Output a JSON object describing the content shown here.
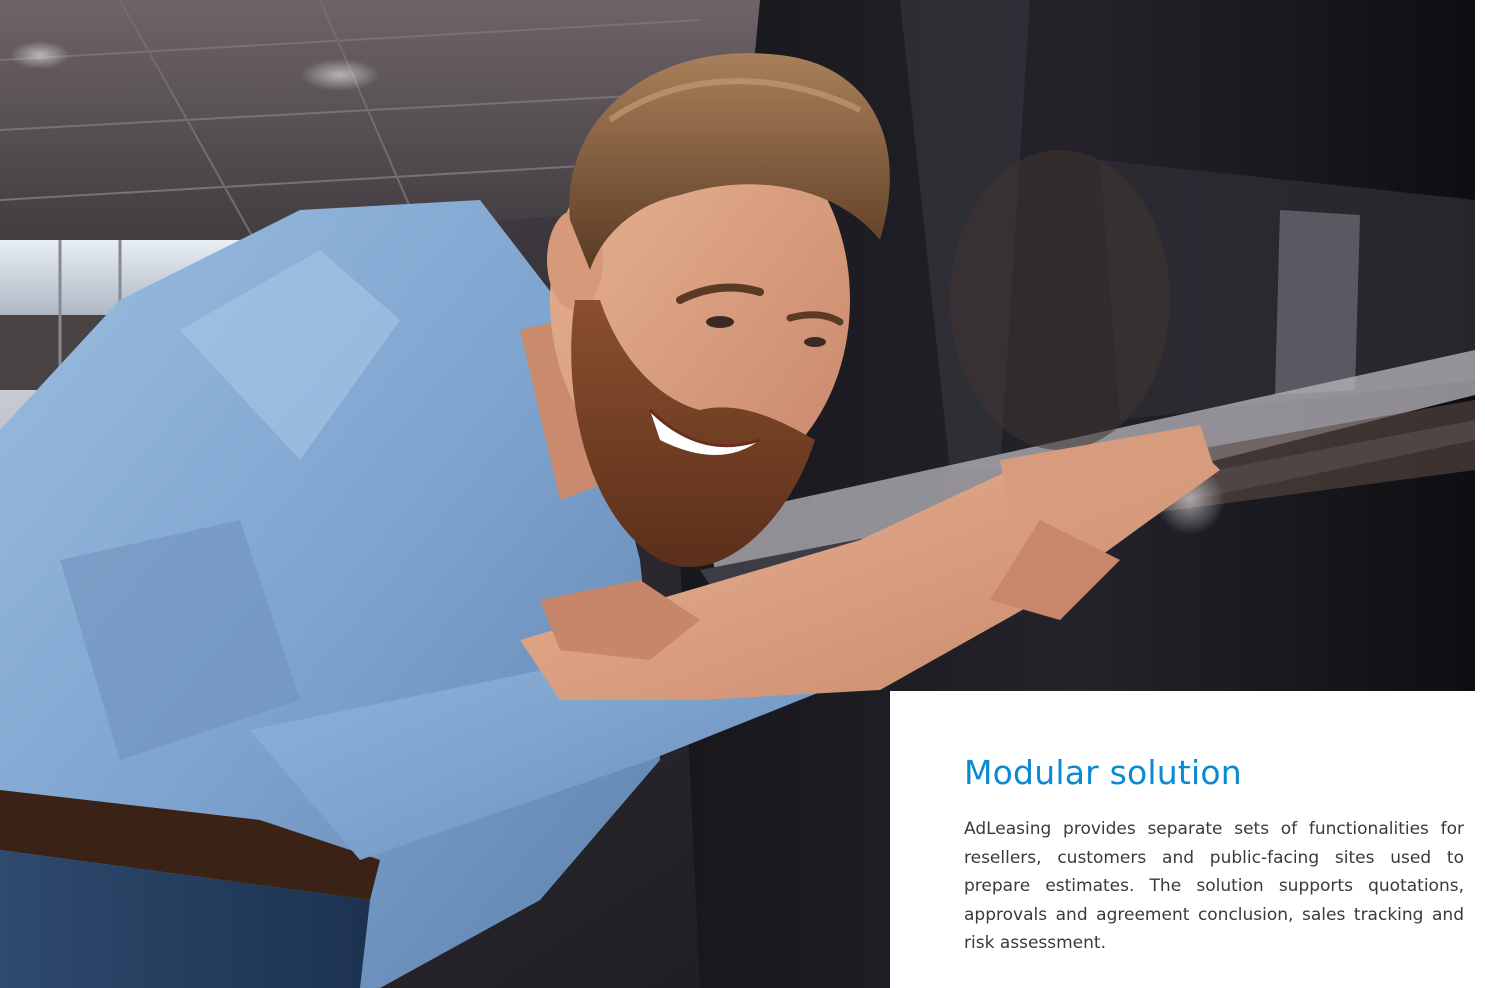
{
  "info_card": {
    "title": "Modular solution",
    "description": "AdLeasing provides separate sets of functionalities for resellers, customers and public-facing sites used to prepare estimates. The solution supports quotations, approvals and agreement conclusion, sales tracking and risk assessment."
  },
  "colors": {
    "title_accent": "#0a8bd0",
    "body_text": "#3a3a3a",
    "card_background": "#ffffff"
  }
}
